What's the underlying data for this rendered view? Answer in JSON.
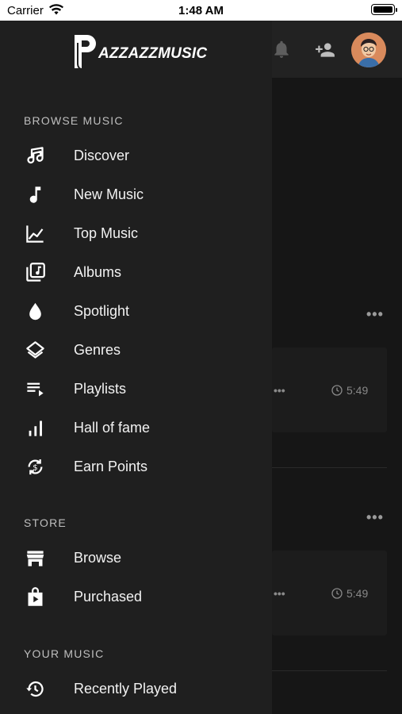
{
  "status_bar": {
    "carrier": "Carrier",
    "time": "1:48 AM"
  },
  "brand": {
    "logo_text": "AZZAZZMUSIC",
    "logo_letter": "P"
  },
  "sections": {
    "browse": "BROWSE MUSIC",
    "store": "STORE",
    "your_music": "YOUR MUSIC"
  },
  "browse_items": [
    {
      "label": "Discover",
      "icon": "music-notes-icon"
    },
    {
      "label": "New Music",
      "icon": "music-note-icon"
    },
    {
      "label": "Top Music",
      "icon": "line-chart-icon"
    },
    {
      "label": "Albums",
      "icon": "library-music-icon"
    },
    {
      "label": "Spotlight",
      "icon": "drop-icon"
    },
    {
      "label": "Genres",
      "icon": "layers-icon"
    },
    {
      "label": "Playlists",
      "icon": "playlist-play-icon"
    },
    {
      "label": "Hall of fame",
      "icon": "bar-chart-icon"
    },
    {
      "label": "Earn Points",
      "icon": "currency-exchange-icon"
    }
  ],
  "store_items": [
    {
      "label": "Browse",
      "icon": "storefront-icon"
    },
    {
      "label": "Purchased",
      "icon": "shopping-bag-icon"
    }
  ],
  "your_music_items": [
    {
      "label": "Recently Played",
      "icon": "history-icon"
    }
  ],
  "background": {
    "tracks": [
      {
        "duration": "5:49"
      },
      {
        "duration": "5:49"
      }
    ]
  }
}
